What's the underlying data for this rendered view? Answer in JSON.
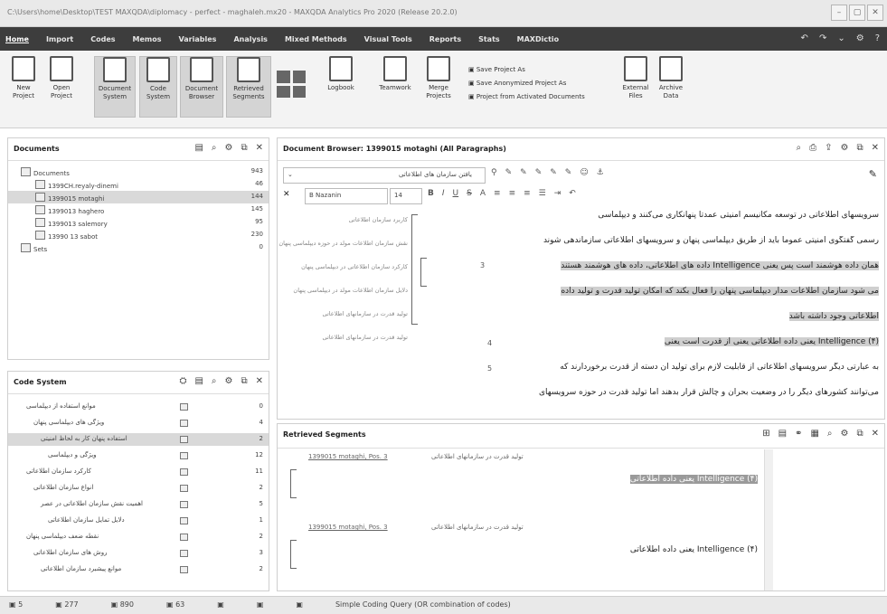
{
  "window": {
    "title": "C:\\Users\\home\\Desktop\\TEST MAXQDA\\diplomacy - perfect - maghaleh.mx20 - MAXQDA Analytics Pro 2020 (Release 20.2.0)"
  },
  "menu": {
    "items": [
      "Home",
      "Import",
      "Codes",
      "Memos",
      "Variables",
      "Analysis",
      "Mixed Methods",
      "Visual Tools",
      "Reports",
      "Stats",
      "MAXDictio"
    ],
    "active": "Home"
  },
  "ribbon": {
    "new_project": "New Project",
    "open_project": "Open Project",
    "document_system": "Document System",
    "code_system": "Code System",
    "document_browser": "Document Browser",
    "retrieved_segments": "Retrieved Segments",
    "logbook": "Logbook",
    "teamwork": "Teamwork",
    "merge_projects": "Merge Projects",
    "save_project_as": "Save Project As",
    "save_anonymized": "Save Anonymized Project As",
    "project_from_activated": "Project from Activated Documents",
    "external_files": "External Files",
    "archive_data": "Archive Data"
  },
  "documents_panel": {
    "title": "Documents",
    "rows": [
      {
        "label": "Documents",
        "count": "943",
        "level": 0
      },
      {
        "label": "1399CH.reyaly-dinemi",
        "count": "46",
        "level": 1
      },
      {
        "label": "1399015 motaghi",
        "count": "144",
        "level": 1,
        "selected": true
      },
      {
        "label": "1399013 haghero",
        "count": "145",
        "level": 1
      },
      {
        "label": "1399013 salemory",
        "count": "95",
        "level": 1
      },
      {
        "label": "13990 13 sabot",
        "count": "230",
        "level": 1
      },
      {
        "label": "Sets",
        "count": "0",
        "level": 0
      }
    ]
  },
  "code_panel": {
    "title": "Code System",
    "rows": [
      {
        "label": "موانع استفاده از دیپلماسی",
        "count": "0"
      },
      {
        "label": "ویژگی های دیپلماسی پنهان",
        "count": "4"
      },
      {
        "label": "استفاده پنهان کار به لحاظ امنیتی",
        "count": "2",
        "selected": true
      },
      {
        "label": "ویژگی و دیپلماسی",
        "count": "12"
      },
      {
        "label": "کارکرد سازمان اطلاعاتی",
        "count": "11"
      },
      {
        "label": "انواع سازمان اطلاعاتی",
        "count": "2"
      },
      {
        "label": "اهمیت نقش سازمان اطلاعاتی در عصر",
        "count": "5"
      },
      {
        "label": "دلایل تمایل سازمان اطلاعاتی",
        "count": "1"
      },
      {
        "label": "نقطه ضعف دیپلماسی پنهان",
        "count": "2"
      },
      {
        "label": "روش های سازمان اطلاعاتی",
        "count": "3"
      },
      {
        "label": "موانع پیشبرد سازمان اطلاعاتی",
        "count": "2"
      }
    ]
  },
  "browser": {
    "title": "Document Browser: 1399015 motaghi (All Paragraphs)",
    "search_placeholder": "یافتن سازمان های اطلاعاتی",
    "font_name": "B Nazanin",
    "font_size": "14",
    "lines": [
      {
        "num": "",
        "text": "سرویسهای اطلاعاتی در توسعه مکانیسم امنیتی عمدتاً پنهانکاری می‌کنند و دیپلماسی",
        "style": "plain"
      },
      {
        "num": "",
        "text": "رسمی گفتگوی امنیتی عموماً باید از طریق دیپلماسی پنهان و سرویسهای اطلاعاتی سازماندهی شوند",
        "style": "plain"
      },
      {
        "num": "",
        "text": "همان داده هوشمند است پس یعنی Intelligence داده های اطلاعاتی، داده های هوشمند هستند",
        "style": "hl"
      },
      {
        "num": "",
        "text": "می شود سازمان اطلاعات مدار دیپلماسی پنهان را فعال بکند که امکان تولید قدرت و تولید داده",
        "style": "hl"
      },
      {
        "num": "",
        "text": "اطلاعاتی وجود داشته باشد",
        "style": "hl"
      },
      {
        "num": "4",
        "text": "(۴) Intelligence یعنی داده اطلاعاتی یعنی از قدرت است یعنی",
        "style": "hl"
      },
      {
        "num": "5",
        "text": "به عبارتی دیگر سرویسهای اطلاعاتی از قابلیت لازم برای تولید آن دسته از قدرت برخوردارند که",
        "style": "plain"
      },
      {
        "num": "",
        "text": "می‌توانند کشورهای دیگر را در وضعیت بحران و چالش قرار بدهند اما تولید قدرت در حوزه سرویسهای",
        "style": "plain"
      }
    ],
    "margin_codes": [
      "کاربرد سازمان اطلاعاتی",
      "نقش سازمان اطلاعات مولد در حوزه دیپلماسی پنهان",
      "کارکرد سازمان اطلاعاتی در دیپلماسی پنهان",
      "دلایل سازمان اطلاعات مولد در دیپلماسی پنهان",
      "تولید قدرت در سازمانهای اطلاعاتی",
      "تولید قدرت در سازمانهای اطلاعاتی"
    ],
    "margin_num": "3"
  },
  "retrieved": {
    "title": "Retrieved Segments",
    "items": [
      {
        "source": "1399015 motaghi, Pos. 3",
        "code": "تولید قدرت در سازمانهای اطلاعاتی",
        "text": "(۴) Intelligence یعنی داده اطلاعاتی"
      },
      {
        "source": "1399015 motaghi, Pos. 3",
        "code": "تولید قدرت در سازمانهای اطلاعاتی",
        "text": "(۴) Intelligence یعنی داده اطلاعاتی"
      }
    ]
  },
  "status": {
    "items": [
      "5",
      "277",
      "890",
      "63",
      "",
      "",
      ""
    ],
    "message": "Simple Coding Query (OR combination of codes)"
  }
}
